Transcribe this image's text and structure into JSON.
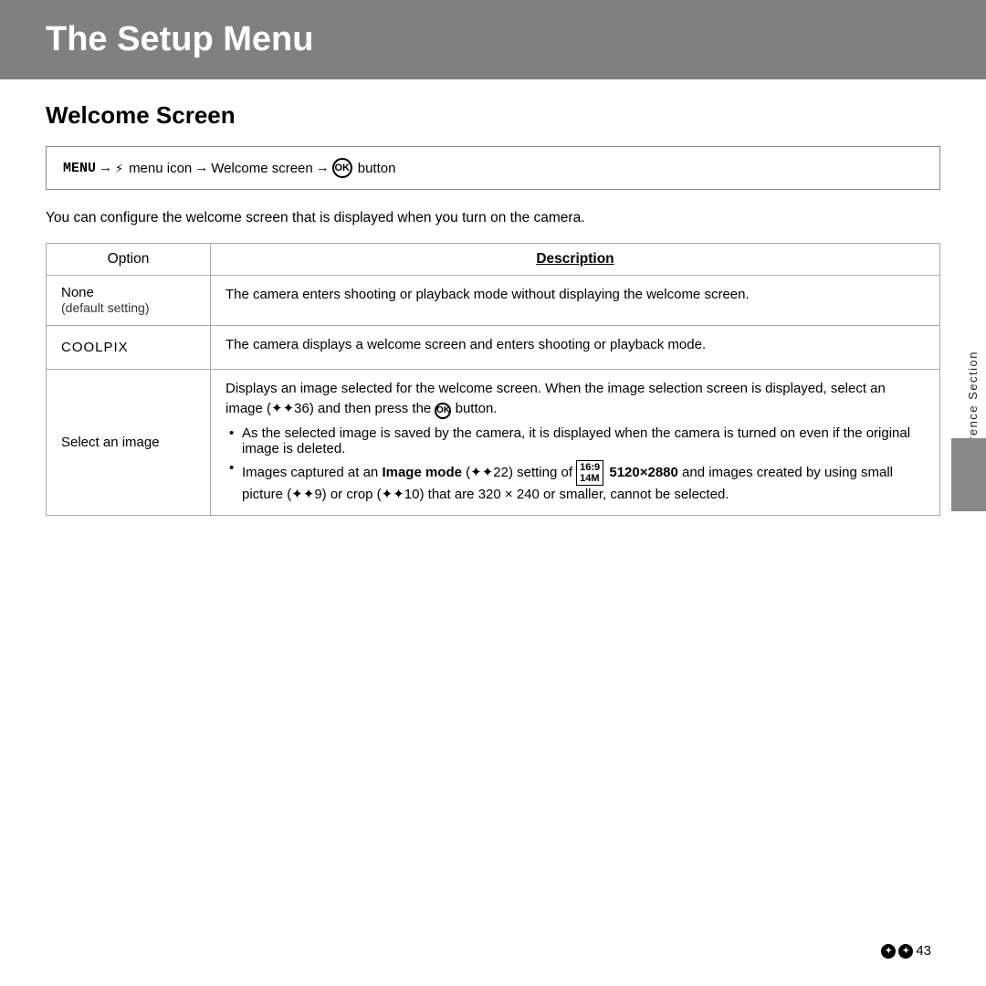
{
  "header": {
    "title": "The Setup Menu",
    "bg_color": "#808080"
  },
  "section": {
    "title": "Welcome Screen"
  },
  "breadcrumb": {
    "menu_label": "MENU",
    "arrow1": "→",
    "wrench": "⚙",
    "menu_icon_label": "menu icon",
    "arrow2": "→",
    "welcome_label": "Welcome screen",
    "arrow3": "→",
    "ok_label": "OK",
    "button_label": "button"
  },
  "description": "You can configure the welcome screen that is displayed when you turn on the camera.",
  "table": {
    "col1_header": "Option",
    "col2_header": "Description",
    "rows": [
      {
        "option": "None",
        "option_sub": "(default setting)",
        "description": "The camera enters shooting or playback mode without displaying the welcome screen."
      },
      {
        "option": "COOLPIX",
        "option_sub": "",
        "description": "The camera displays a welcome screen and enters shooting or playback mode."
      },
      {
        "option": "Select an image",
        "option_sub": "",
        "description_main": "Displays an image selected for the welcome screen. When the image selection screen is displayed, select an image (❻❼36) and then press the ⊛ button.",
        "bullets": [
          "As the selected image is saved by the camera, it is displayed when the camera is turned on even if the original image is deleted.",
          "Images captured at an Image mode (❻❼22) setting of 5120×2880 and images created by using small picture (❻❼9) or crop (❻❼10) that are 320 × 240 or smaller, cannot be selected."
        ]
      }
    ]
  },
  "sidebar": {
    "label": "Reference Section"
  },
  "page_number": "●❼43"
}
